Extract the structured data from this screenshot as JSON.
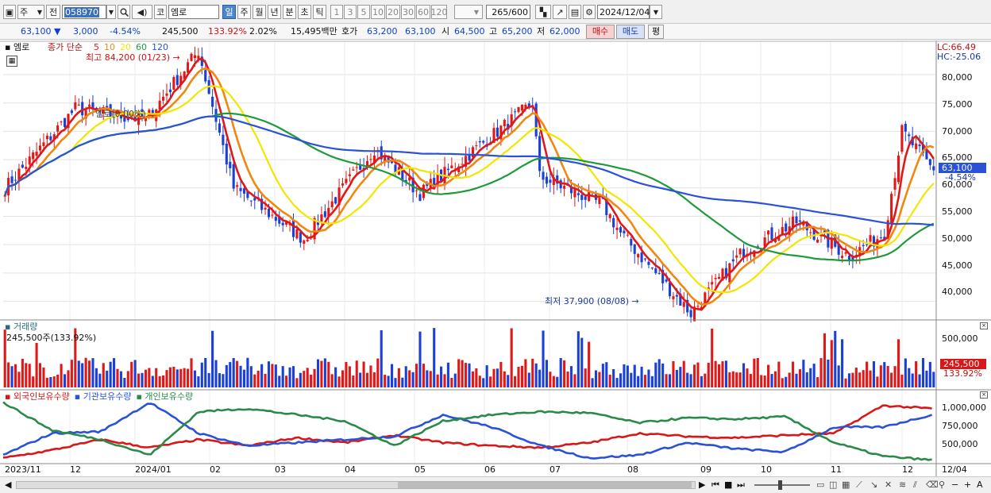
{
  "toolbar": {
    "market_label": "주",
    "prev_label": "전",
    "code": "058970",
    "change_amount": "3,000",
    "name_prefix": "코",
    "name": "엠로",
    "periods": [
      "일",
      "주",
      "월",
      "년",
      "분",
      "초",
      "틱"
    ],
    "active_period": "일",
    "intervals": [
      "1",
      "3",
      "5",
      "10",
      "20",
      "30",
      "60",
      "120"
    ],
    "count": "265",
    "count_total": "/600",
    "date": "2024/12/04"
  },
  "quote": {
    "price": "63,100",
    "arrow": "▼",
    "change": "3,000",
    "change_pct": "-4.54%",
    "volume": "245,500",
    "volume_ratio": "133.92%",
    "turnover": "2.02%",
    "amount": "15,495백만",
    "hoga_label": "호가",
    "ask": "63,200",
    "bid": "63,100",
    "open_label": "시",
    "open": "64,500",
    "high_label": "고",
    "high": "65,200",
    "low_label": "저",
    "low": "62,000",
    "buy_label": "매수",
    "sell_label": "매도",
    "eval_label": "평"
  },
  "price_panel": {
    "title": "엠로",
    "ma_label": "종가 단순",
    "ma_periods": [
      "5",
      "10",
      "20",
      "60",
      "120"
    ],
    "ma_colors": [
      "#e01818",
      "#f0870e",
      "#f2e600",
      "#1f9a3a",
      "#2a52d8"
    ],
    "lc": "LC:66.49",
    "hc": "HC:-25.06",
    "current_price": "63,100",
    "current_pct": "-4.54%",
    "high_note": "최고 84,200 (01/23)",
    "low_note": "최저 37,900 (08/08)",
    "overlay_note": "엠로(0.00%)",
    "y_ticks": [
      "80,000",
      "75,000",
      "70,000",
      "65,000",
      "60,000",
      "55,000",
      "50,000",
      "45,000",
      "40,000"
    ]
  },
  "volume_panel": {
    "title": "거래량",
    "info": "245,500주(133.92%)",
    "y_ticks": [
      "500,000",
      "250,000"
    ],
    "current": "245,500",
    "current_pct": "133.92%"
  },
  "holding_panel": {
    "series": [
      "외국인보유수량",
      "기관보유수량",
      "개인보유수량"
    ],
    "colors": [
      "#d81818",
      "#2a52d8",
      "#2a8a4a"
    ],
    "y_ticks": [
      "1,000,000",
      "750,000",
      "500,000"
    ]
  },
  "x_axis": {
    "labels": [
      "2023/11",
      "12",
      "2024/01",
      "02",
      "03",
      "04",
      "05",
      "06",
      "07",
      "08",
      "09",
      "10",
      "11",
      "12",
      "12/04"
    ]
  },
  "chart_data": {
    "type": "candlestick",
    "x_range": [
      "2023/11",
      "2024/12/04"
    ],
    "y_range": [
      37000,
      83500
    ],
    "ma_periods": [
      5,
      10,
      20,
      60,
      120
    ],
    "close_points": [
      {
        "date": "2023/11",
        "close": 60000
      },
      {
        "date": "2023/12",
        "close": 74000
      },
      {
        "date": "2024/01",
        "close": 72000
      },
      {
        "date": "2024/01/23",
        "close": 84200
      },
      {
        "date": "2024/02",
        "close": 60000
      },
      {
        "date": "2024/03",
        "close": 51000
      },
      {
        "date": "2024/04",
        "close": 67000
      },
      {
        "date": "2024/04/20",
        "close": 59000
      },
      {
        "date": "2024/05",
        "close": 64000
      },
      {
        "date": "2024/05/30",
        "close": 75000
      },
      {
        "date": "2024/06",
        "close": 62000
      },
      {
        "date": "2024/07",
        "close": 57000
      },
      {
        "date": "2024/07/25",
        "close": 52000
      },
      {
        "date": "2024/08/08",
        "close": 37900
      },
      {
        "date": "2024/09",
        "close": 49000
      },
      {
        "date": "2024/09/25",
        "close": 54000
      },
      {
        "date": "2024/10",
        "close": 48000
      },
      {
        "date": "2024/11",
        "close": 52000
      },
      {
        "date": "2024/11/20",
        "close": 70000
      },
      {
        "date": "2024/12/04",
        "close": 63100
      }
    ]
  }
}
